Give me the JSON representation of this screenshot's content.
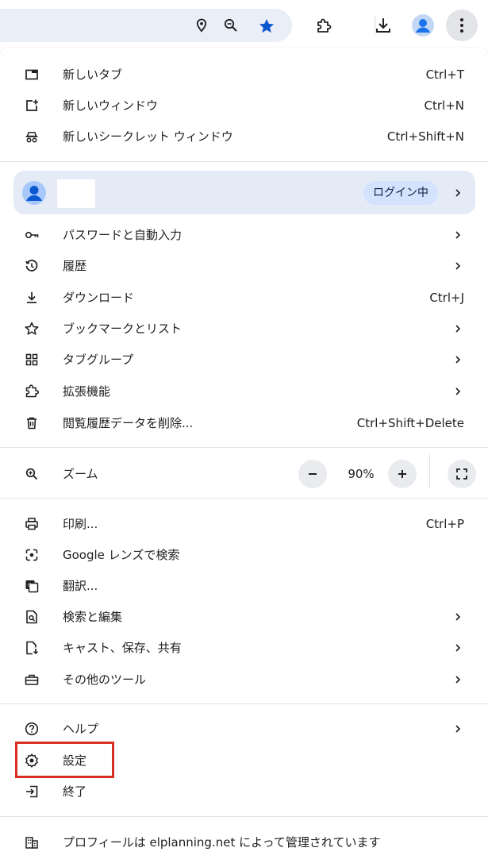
{
  "toolbar": {
    "icons": [
      "location-pin-icon",
      "zoom-icon",
      "bookmark-star-icon",
      "extensions-icon",
      "downloads-icon",
      "profile-avatar-icon",
      "menu-kebab-icon"
    ],
    "accent_color": "#0b57d0"
  },
  "menu": {
    "group1": [
      {
        "label": "新しいタブ",
        "shortcut": "Ctrl+T",
        "icon": "new-tab-icon"
      },
      {
        "label": "新しいウィンドウ",
        "shortcut": "Ctrl+N",
        "icon": "new-window-icon"
      },
      {
        "label": "新しいシークレット ウィンドウ",
        "shortcut": "Ctrl+Shift+N",
        "icon": "incognito-icon"
      }
    ],
    "profile": {
      "status_badge": "ログイン中"
    },
    "group2": [
      {
        "label": "パスワードと自動入力",
        "shortcut": "",
        "icon": "key-icon"
      },
      {
        "label": "履歴",
        "shortcut": "",
        "icon": "history-icon"
      },
      {
        "label": "ダウンロード",
        "shortcut": "Ctrl+J",
        "icon": "download-icon"
      },
      {
        "label": "ブックマークとリスト",
        "shortcut": "",
        "icon": "star-icon"
      },
      {
        "label": "タブグループ",
        "shortcut": "",
        "icon": "tab-groups-icon"
      },
      {
        "label": "拡張機能",
        "shortcut": "",
        "icon": "extensions-icon"
      },
      {
        "label": "閲覧履歴データを削除...",
        "shortcut": "Ctrl+Shift+Delete",
        "icon": "trash-icon"
      }
    ],
    "zoom": {
      "label": "ズーム",
      "value": "90%",
      "minus": "−",
      "plus": "+"
    },
    "group3": [
      {
        "label": "印刷...",
        "shortcut": "Ctrl+P",
        "icon": "print-icon"
      },
      {
        "label": "Google レンズで検索",
        "shortcut": "",
        "icon": "lens-icon"
      },
      {
        "label": "翻訳...",
        "shortcut": "",
        "icon": "translate-icon"
      },
      {
        "label": "検索と編集",
        "shortcut": "",
        "icon": "find-edit-icon"
      },
      {
        "label": "キャスト、保存、共有",
        "shortcut": "",
        "icon": "cast-save-share-icon"
      },
      {
        "label": "その他のツール",
        "shortcut": "",
        "icon": "toolbox-icon"
      }
    ],
    "group4": [
      {
        "label": "ヘルプ",
        "shortcut": "",
        "icon": "help-icon"
      },
      {
        "label": "設定",
        "shortcut": "",
        "icon": "settings-icon"
      },
      {
        "label": "終了",
        "shortcut": "",
        "icon": "exit-icon"
      }
    ],
    "managed": {
      "label": "プロフィールは elplanning.net によって管理されています",
      "icon": "building-icon"
    }
  },
  "highlight_color": "#d93025"
}
